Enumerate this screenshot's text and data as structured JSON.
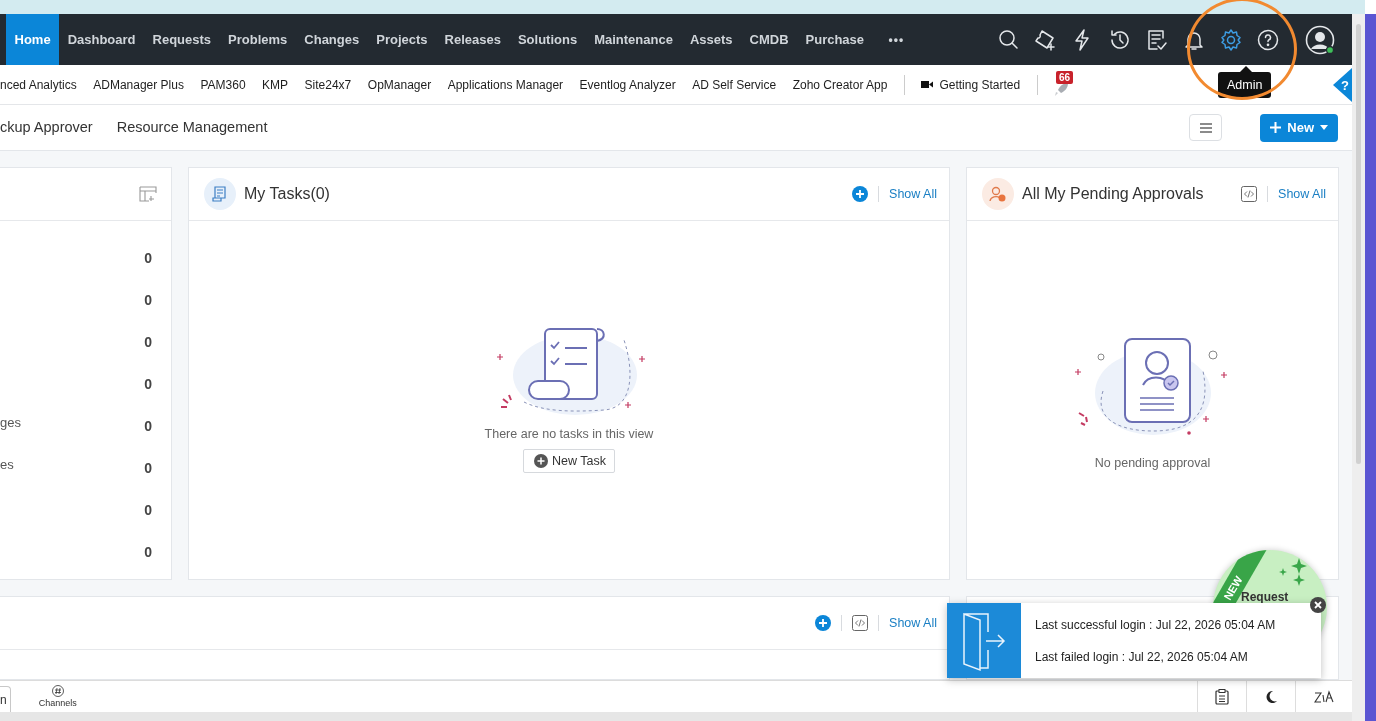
{
  "nav": {
    "items": [
      {
        "label": "Home",
        "selected": true
      },
      {
        "label": "Dashboard",
        "selected": false
      },
      {
        "label": "Requests",
        "selected": false
      },
      {
        "label": "Problems",
        "selected": false
      },
      {
        "label": "Changes",
        "selected": false
      },
      {
        "label": "Projects",
        "selected": false
      },
      {
        "label": "Releases",
        "selected": false
      },
      {
        "label": "Solutions",
        "selected": false
      },
      {
        "label": "Maintenance",
        "selected": false
      },
      {
        "label": "Assets",
        "selected": false
      },
      {
        "label": "CMDB",
        "selected": false
      },
      {
        "label": "Purchase",
        "selected": false
      }
    ],
    "more": "•••",
    "icons": [
      {
        "kind": "search",
        "selected": false
      },
      {
        "kind": "ticket-add",
        "selected": false
      },
      {
        "kind": "lightning",
        "selected": false
      },
      {
        "kind": "history",
        "selected": false
      },
      {
        "kind": "checklist",
        "selected": false
      },
      {
        "kind": "bell",
        "selected": false
      },
      {
        "kind": "gear",
        "selected": true
      },
      {
        "kind": "help",
        "selected": false
      }
    ],
    "profile": {
      "online": true
    },
    "tooltip": "Admin"
  },
  "links": {
    "items": [
      "nced Analytics",
      "ADManager Plus",
      "PAM360",
      "KMP",
      "Site24x7",
      "OpManager",
      "Applications Manager",
      "Eventlog Analyzer",
      "AD Self Service",
      "Zoho Creator App"
    ],
    "video_link": "Getting Started",
    "badge": "66",
    "help_tab": "?"
  },
  "tabs": [
    {
      "label": "ckup Approver",
      "selected": false
    },
    {
      "label": "Resource Management",
      "selected": false
    }
  ],
  "new_button": "New",
  "summary_card": {
    "rows": [
      {
        "value": "0"
      },
      {
        "value": "0"
      },
      {
        "value": "0"
      },
      {
        "value": "0"
      },
      {
        "label": "ges",
        "value": "0"
      },
      {
        "label": "es",
        "value": "0"
      },
      {
        "value": "0"
      },
      {
        "value": "0"
      }
    ]
  },
  "tasks_card": {
    "title": "My Tasks(0)",
    "show_all": "Show All",
    "empty_text": "There are no tasks in this view",
    "new_task": "New Task"
  },
  "approvals_card": {
    "title": "All My Pending Approvals",
    "show_all": "Show All",
    "empty_text": "No pending approval"
  },
  "lower_card": {
    "show_all": "Show All"
  },
  "bottom_bar": {
    "partial_tab": "n",
    "channels": "Channels"
  },
  "promo": {
    "ribbon": "NEW",
    "label": "Request"
  },
  "login_toast": {
    "lines": [
      "Last successful login : Jul 22, 2026 05:04 AM",
      "Last failed login : Jul 22, 2026 05:04 AM"
    ]
  }
}
